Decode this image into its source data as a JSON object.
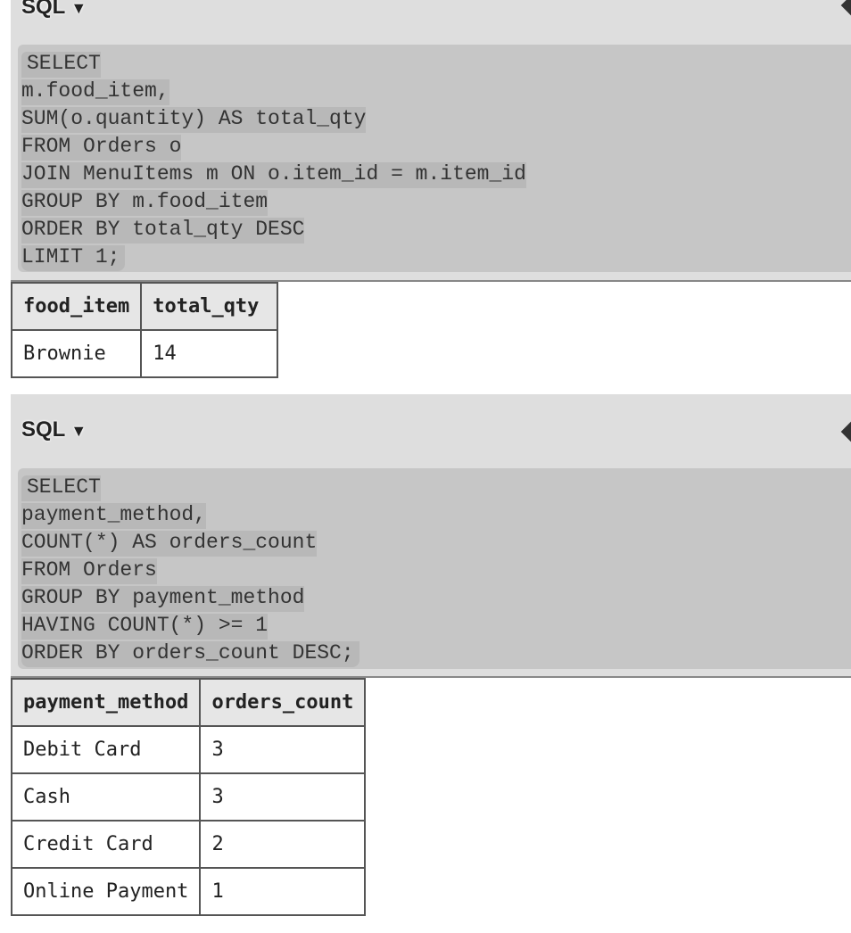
{
  "blocks": [
    {
      "header": "SQL",
      "toggle_icon": "triangle-down",
      "code": [
        "SELECT",
        "m.food_item,",
        "SUM(o.quantity) AS total_qty",
        "FROM Orders o",
        "JOIN MenuItems m ON o.item_id = m.item_id",
        "GROUP BY m.food_item",
        "ORDER BY total_qty DESC",
        "LIMIT 1;"
      ],
      "columns": [
        "food_item",
        "total_qty"
      ],
      "rows": [
        [
          "Brownie",
          "14"
        ]
      ]
    },
    {
      "header": "SQL",
      "toggle_icon": "triangle-down",
      "code": [
        "SELECT",
        "payment_method,",
        "COUNT(*) AS orders_count",
        "FROM Orders",
        "GROUP BY payment_method",
        "HAVING COUNT(*) >= 1",
        "ORDER BY orders_count DESC;"
      ],
      "columns": [
        "payment_method",
        "orders_count"
      ],
      "rows": [
        [
          "Debit Card",
          "3"
        ],
        [
          "Cash",
          "3"
        ],
        [
          "Credit Card",
          "2"
        ],
        [
          "Online Payment",
          "1"
        ]
      ]
    }
  ],
  "arrow": "▼"
}
